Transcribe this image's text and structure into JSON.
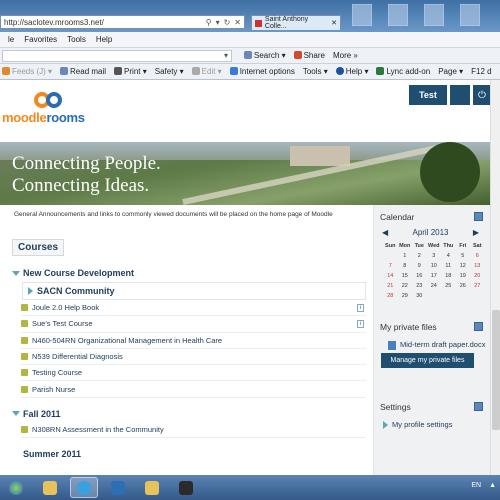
{
  "browser": {
    "url": "http://saclotev.mrooms3.net/",
    "addr_controls": [
      "⚲",
      "▾",
      "↻",
      "✕"
    ],
    "tab_title": "Saint Anthony Colle...",
    "tab_close": "✕",
    "menu": [
      "le",
      "Favorites",
      "Tools",
      "Help"
    ],
    "fav_items": [
      "Search ▾",
      "Share",
      "More »"
    ],
    "cmd_items": [
      "Feeds (J) ▾",
      "Read mail",
      "Print ▾",
      "Safety ▾",
      "Edit ▾",
      "Internet options",
      "Tools ▾",
      "Help ▾",
      "Lync add-on",
      "Page ▾",
      "F12 d"
    ]
  },
  "header": {
    "logo_part1": "moodle",
    "logo_part2": "rooms",
    "test_button": "Test",
    "power_glyph": "⏻"
  },
  "banner": {
    "line1": "Connecting People.",
    "line2": "Connecting Ideas."
  },
  "main": {
    "announcement": "General Announcements and links to commonly viewed documents will be placed on the home page of Moodle",
    "courses_tab": "Courses",
    "categories": [
      {
        "name": "New Course Development",
        "sub": "SACN Community",
        "courses": [
          {
            "name": "Joule 2.0 Help Book",
            "info": true
          },
          {
            "name": "Sue's Test Course",
            "info": true
          },
          {
            "name": "N460-504RN Organizational Management in Health Care",
            "info": false
          },
          {
            "name": "N539 Differential Diagnosis",
            "info": false
          },
          {
            "name": "Testing Course",
            "info": false
          },
          {
            "name": "Parish Nurse",
            "info": false
          }
        ]
      },
      {
        "name": "Fall 2011",
        "courses": [
          {
            "name": "N308RN Assessment in the Community",
            "info": false
          }
        ]
      },
      {
        "name": "Summer 2011",
        "courses": []
      }
    ],
    "info_glyph": "i"
  },
  "sidebar": {
    "calendar_title": "Calendar",
    "prev": "◀",
    "next": "▶",
    "month": "April 2013",
    "weekdays": [
      "Sun",
      "Mon",
      "Tue",
      "Wed",
      "Thu",
      "Fri",
      "Sat"
    ],
    "weeks": [
      [
        "",
        "1",
        "2",
        "3",
        "4",
        "5",
        "6"
      ],
      [
        "7",
        "8",
        "9",
        "10",
        "11",
        "12",
        "13"
      ],
      [
        "14",
        "15",
        "16",
        "17",
        "18",
        "19",
        "20"
      ],
      [
        "21",
        "22",
        "23",
        "24",
        "25",
        "26",
        "27"
      ],
      [
        "28",
        "29",
        "30",
        "",
        "",
        "",
        ""
      ]
    ],
    "files_title": "My private files",
    "file_name": "Mid-term draft paper.docx",
    "manage_button": "Manage my private files",
    "settings_title": "Settings",
    "settings_item": "My profile settings"
  },
  "taskbar": {
    "tray_lang": "EN",
    "tray_arrow": "▲"
  },
  "colors": {
    "brand_dark": "#1f4e70",
    "logo_orange": "#f08a1c",
    "logo_blue": "#2a6db0",
    "link": "#1d3c5a"
  }
}
